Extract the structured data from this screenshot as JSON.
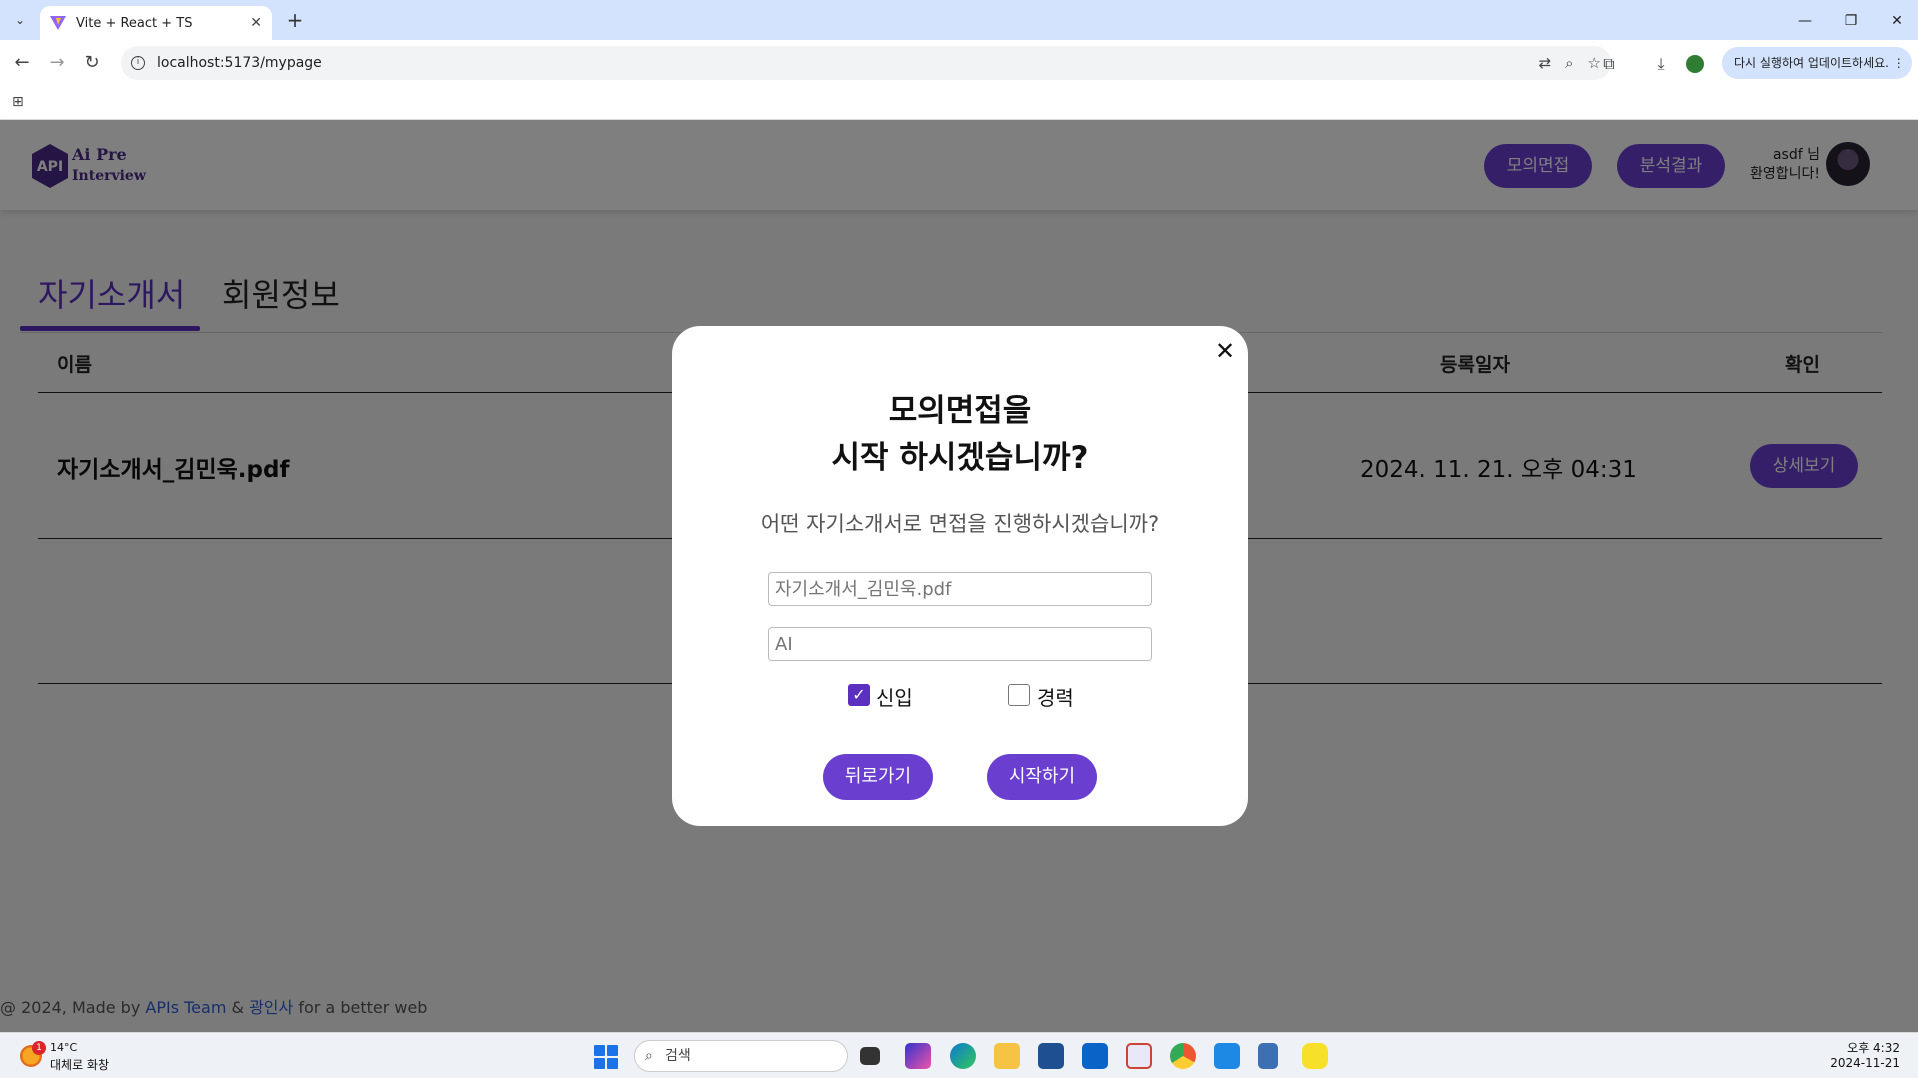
{
  "browser": {
    "tab_title": "Vite + React + TS",
    "url": "localhost:5173/mypage",
    "update_notice": "다시 실행하여 업데이트하세요."
  },
  "header": {
    "logo_text": "API",
    "logo_title_1": "Ai Pre",
    "logo_title_2": "Interview",
    "mock_interview_button": "모의면접",
    "analysis_button": "분석결과",
    "greeting_user": "asdf 님",
    "greeting_text": "환영합니다!"
  },
  "tabs": {
    "resume": "자기소개서",
    "member_info": "회원정보"
  },
  "table": {
    "headers": {
      "name": "이름",
      "date": "등록일자",
      "action": "확인"
    },
    "rows": [
      {
        "name": "자기소개서_김민욱.pdf",
        "date": "2024. 11. 21. 오후 04:31",
        "action": "상세보기"
      }
    ]
  },
  "footer": {
    "prefix": "@ 2024, Made by ",
    "team": "APIs Team",
    "amp": " & ",
    "org": "광인사",
    "suffix": " for a better web"
  },
  "modal": {
    "close_glyph": "✕",
    "title_line1": "모의면접을",
    "title_line2": "시작 하시겠습니까?",
    "subtitle": "어떤 자기소개서로 면접을 진행하시겠습니까?",
    "resume_placeholder": "자기소개서_김민욱.pdf",
    "job_placeholder": "AI",
    "checkbox_newcomer": {
      "label": "신입",
      "checked": true
    },
    "checkbox_experienced": {
      "label": "경력",
      "checked": false
    },
    "back_button": "뒤로가기",
    "start_button": "시작하기"
  },
  "taskbar": {
    "weather_badge": "1",
    "weather_temp": "14°C",
    "weather_desc": "대체로 화창",
    "search_placeholder": "검색",
    "time": "오후 4:32",
    "date": "2024-11-21"
  },
  "colors": {
    "accent": "#6a3fd0",
    "overlay": "rgba(0,0,0,0.5)"
  }
}
